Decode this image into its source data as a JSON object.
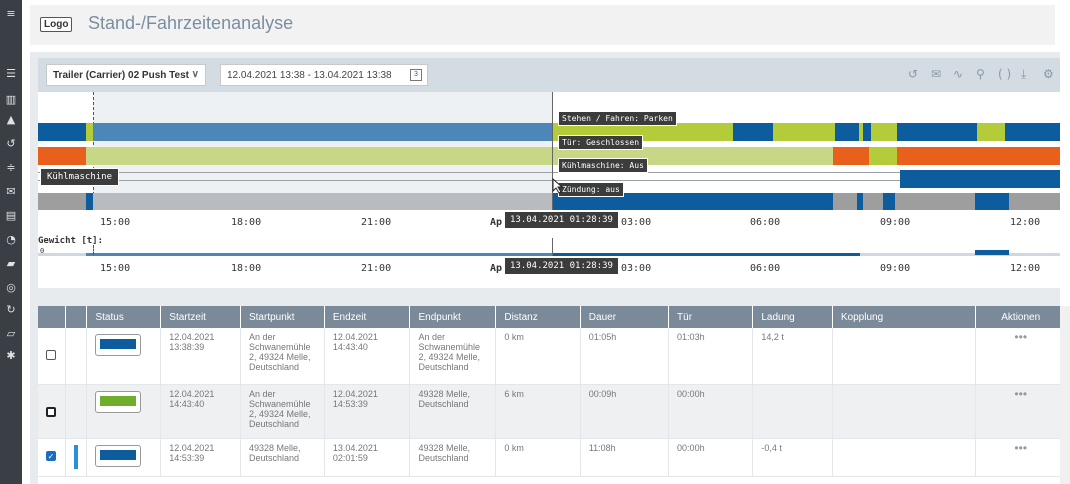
{
  "header": {
    "logo_text": "Logo",
    "title": "Stand-/Fahrzeitenanalyse"
  },
  "toolbar": {
    "trailer": "Trailer (Carrier) 02 Push Test",
    "date_range": "12.04.2021 13:38 - 13.04.2021 13:38",
    "calendar_day": "3",
    "icons": [
      "history-icon",
      "mail-icon",
      "route-icon",
      "location-pin-icon",
      "brackets-icon",
      "download-icon",
      "gear-icon"
    ]
  },
  "timeline": {
    "tooltips": {
      "stehen": "Stehen / Fahren: Parken",
      "tuer": "Tür: Geschlossen",
      "kuehl": "Kühlmaschine: Aus",
      "zuendung": "Zündung: aus"
    },
    "lane_label": "Kühlmaschine",
    "cursor_time": "13.04.2021 01:28:39",
    "ticks": [
      "15:00",
      "18:00",
      "21:00",
      "Ap",
      "03:00",
      "06:00",
      "09:00",
      "12:00"
    ],
    "weight_label": "Gewicht [t]:",
    "weight_zero": "0"
  },
  "colors": {
    "blue": "#0d5c9e",
    "green": "#b4cc3a",
    "orange": "#e8601c",
    "gray": "#9e9e9e",
    "light_green": "#c7d786"
  },
  "table": {
    "headers": [
      "",
      "",
      "Status",
      "Startzeit",
      "Startpunkt",
      "Endzeit",
      "Endpunkt",
      "Distanz",
      "Dauer",
      "Tür",
      "Ladung",
      "Kopplung",
      "Aktionen"
    ],
    "rows": [
      {
        "start_time": "12.04.2021 13:38:39",
        "start_point": "An der Schwanemühle 2, 49324 Melle, Deutschland",
        "end_time": "12.04.2021 14:43:40",
        "end_point": "An der Schwanemühle 2, 49324 Melle, Deutschland",
        "distance": "0 km",
        "duration": "01:05h",
        "door": "01:03h",
        "load": "14,2 t",
        "coupling": "",
        "actions": "•••",
        "status_color": "blue",
        "checked": false
      },
      {
        "start_time": "12.04.2021 14:43:40",
        "start_point": "An der Schwanemühle 2, 49324 Melle, Deutschland",
        "end_time": "12.04.2021 14:53:39",
        "end_point": "49328 Melle, Deutschland",
        "distance": "6 km",
        "duration": "00:09h",
        "door": "00:00h",
        "load": "",
        "coupling": "",
        "actions": "•••",
        "status_color": "green",
        "checked": false
      },
      {
        "start_time": "12.04.2021 14:53:39",
        "start_point": "49328 Melle, Deutschland",
        "end_time": "13.04.2021 02:01:59",
        "end_point": "49328 Melle, Deutschland",
        "distance": "0 km",
        "duration": "11:08h",
        "door": "00:00h",
        "load": "-0,4 t",
        "coupling": "",
        "actions": "•••",
        "status_color": "blue",
        "checked": true
      }
    ]
  }
}
